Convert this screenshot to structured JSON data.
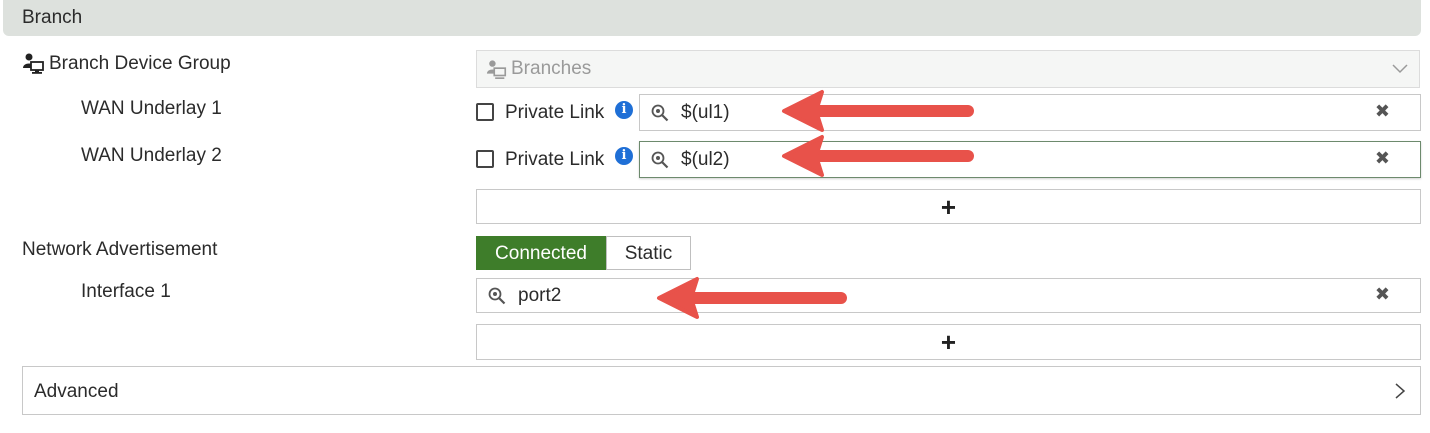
{
  "section": {
    "title": "Branch"
  },
  "device_group": {
    "label": "Branch Device Group",
    "value": "Branches"
  },
  "underlays": [
    {
      "label": "WAN Underlay 1",
      "private_link_label": "Private Link",
      "value": "$(ul1)"
    },
    {
      "label": "WAN Underlay 2",
      "private_link_label": "Private Link",
      "value": "$(ul2)"
    }
  ],
  "network_advertisement": {
    "label": "Network Advertisement",
    "options": [
      "Connected",
      "Static"
    ],
    "selected": "Connected"
  },
  "interfaces": [
    {
      "label": "Interface 1",
      "value": "port2"
    }
  ],
  "advanced": {
    "label": "Advanced"
  },
  "icons": {
    "add": "plus-icon",
    "remove": "close-icon",
    "search": "search-icon",
    "info": "info-icon",
    "expand": "chevron-right-icon",
    "dropdown": "chevron-down-icon",
    "device_group": "device-group-icon"
  },
  "colors": {
    "accent": "#3e7d2a",
    "info": "#1f6fd6",
    "annotation_arrow": "#e8524a"
  }
}
